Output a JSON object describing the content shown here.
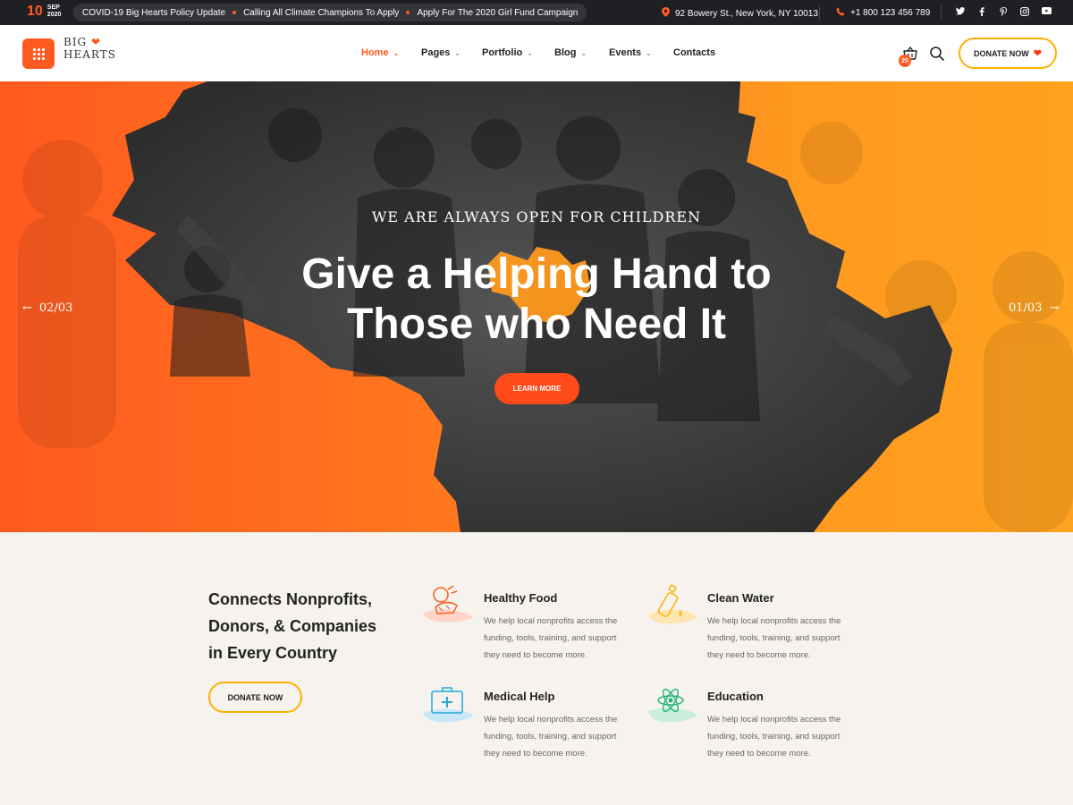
{
  "topbar": {
    "date_day": "10",
    "date_month": "SEP",
    "date_year": "2020",
    "ticker": [
      "COVID-19 Big Hearts Policy Update",
      "Calling All Climate Champions To Apply",
      "Apply For The 2020 Girl Fund Campaign"
    ],
    "address": "92 Bowery St., New York, NY 10013",
    "phone": "+1 800 123 456 789",
    "social_icons": [
      "twitter-icon",
      "facebook-icon",
      "pinterest-icon",
      "instagram-icon",
      "youtube-icon"
    ]
  },
  "header": {
    "logo_line1": "BIG",
    "logo_line2": "HEARTS",
    "nav": [
      {
        "label": "Home",
        "active": true
      },
      {
        "label": "Pages"
      },
      {
        "label": "Portfolio"
      },
      {
        "label": "Blog"
      },
      {
        "label": "Events"
      },
      {
        "label": "Contacts"
      }
    ],
    "cart_count": "25",
    "donate_label": "DONATE NOW"
  },
  "hero": {
    "tagline": "WE ARE ALWAYS OPEN FOR CHILDREN",
    "title_line1": "Give a Helping Hand to",
    "title_line2": "Those who Need It",
    "cta_label": "LEARN MORE",
    "prev_slide": "02/03",
    "next_slide": "01/03"
  },
  "content": {
    "intro_line1": "Connects Nonprofits,",
    "intro_line2": "Donors, & Companies",
    "intro_line3": "in Every Country",
    "donate_label": "DONATE NOW",
    "features": [
      {
        "title": "Healthy Food",
        "desc_line1": "We help local nonprofits access the",
        "desc_line2": "funding, tools, training, and support",
        "desc_line3": "they need to become more.",
        "icon": "food-icon"
      },
      {
        "title": "Clean Water",
        "desc_line1": "We help local nonprofits access the",
        "desc_line2": "funding, tools, training, and support",
        "desc_line3": "they need to become more.",
        "icon": "water-bottle-icon"
      },
      {
        "title": "Medical Help",
        "desc_line1": "We help local nonprofits access the",
        "desc_line2": "funding, tools, training, and support",
        "desc_line3": "they need to become more.",
        "icon": "medical-kit-icon"
      },
      {
        "title": "Education",
        "desc_line1": "We help local nonprofits access the",
        "desc_line2": "funding, tools, training, and support",
        "desc_line3": "they need to become more.",
        "icon": "atom-icon"
      }
    ]
  },
  "colors": {
    "accent": "#ff5a1f",
    "accent_yellow": "#ffb000",
    "topbar_bg": "#1f2024",
    "page_bg": "#f6f3ee"
  }
}
